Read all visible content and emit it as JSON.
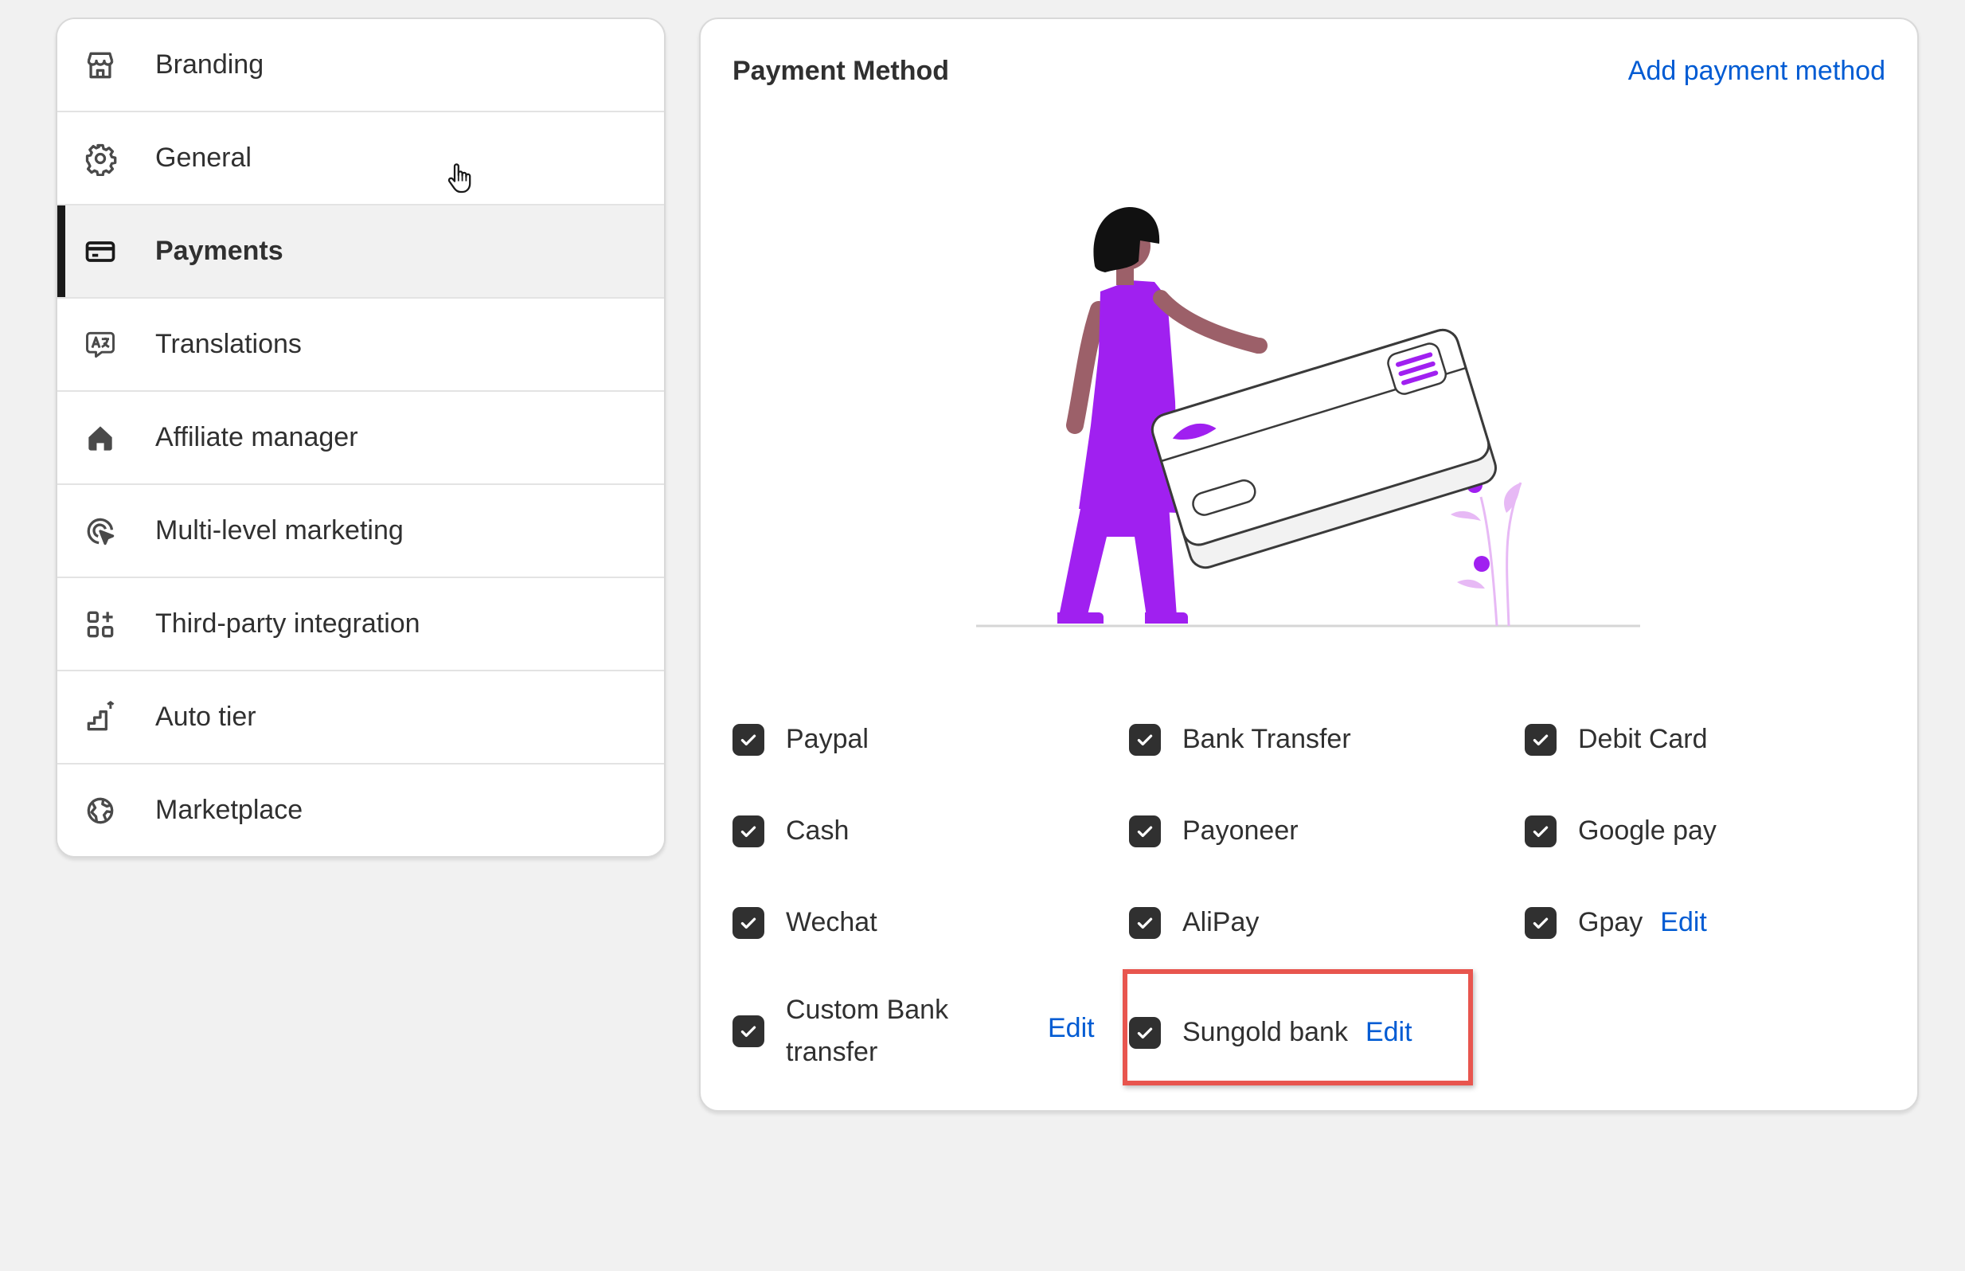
{
  "sidebar": {
    "items": [
      {
        "label": "Branding",
        "icon": "store-icon"
      },
      {
        "label": "General",
        "icon": "gear-icon"
      },
      {
        "label": "Payments",
        "icon": "credit-card-icon"
      },
      {
        "label": "Translations",
        "icon": "translate-icon"
      },
      {
        "label": "Affiliate manager",
        "icon": "home-icon"
      },
      {
        "label": "Multi-level marketing",
        "icon": "target-cursor-icon"
      },
      {
        "label": "Third-party integration",
        "icon": "apps-add-icon"
      },
      {
        "label": "Auto tier",
        "icon": "stairs-icon"
      },
      {
        "label": "Marketplace",
        "icon": "globe-icon"
      }
    ],
    "active": "Payments"
  },
  "main": {
    "title": "Payment Method",
    "add_label": "Add payment method",
    "methods": [
      {
        "label": "Paypal",
        "checked": true
      },
      {
        "label": "Bank Transfer",
        "checked": true
      },
      {
        "label": "Debit Card",
        "checked": true
      },
      {
        "label": "Cash",
        "checked": true
      },
      {
        "label": "Payoneer",
        "checked": true
      },
      {
        "label": "Google pay",
        "checked": true
      },
      {
        "label": "Wechat",
        "checked": true
      },
      {
        "label": "AliPay",
        "checked": true
      },
      {
        "label": "Gpay",
        "checked": true,
        "edit": "Edit"
      },
      {
        "label_line1": "Custom Bank",
        "label_line2": "transfer",
        "checked": true,
        "edit": "Edit"
      },
      {
        "label": "Sungold bank",
        "checked": true,
        "edit": "Edit",
        "highlighted": true
      }
    ]
  },
  "colors": {
    "accent_link": "#005bd3",
    "highlight_border": "#e8554e",
    "illustration_purple": "#a020f0",
    "checkbox": "#303030"
  }
}
